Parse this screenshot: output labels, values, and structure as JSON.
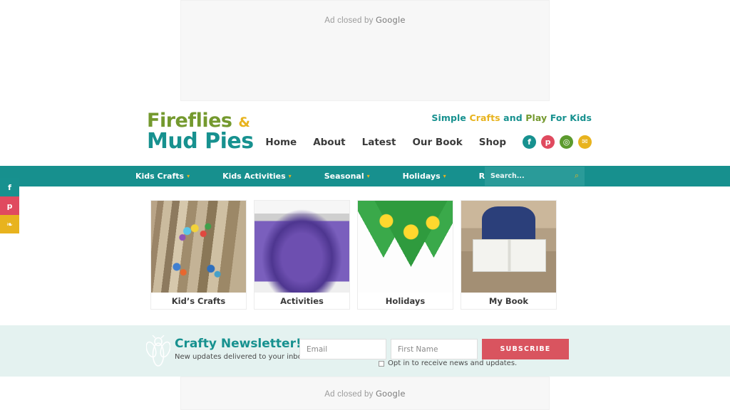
{
  "ads": {
    "top_label_prefix": "Ad closed by ",
    "top_label_brand": "Google",
    "bottom_label_prefix": "Ad closed by ",
    "bottom_label_brand": "Google"
  },
  "colors": {
    "teal": "#17918f",
    "navbar_teal": "#17908e",
    "gold": "#e8b31e",
    "green": "#74992e",
    "red": "#d9545f",
    "newsletter_bg": "#e4f2f0",
    "pinterest_red": "#e04a5f",
    "instagram_green": "#5c9a2e"
  },
  "logo": {
    "line1": "Fireflies",
    "ampersand": "&",
    "line2_word1": "Mud",
    "line2_word2": "Pies"
  },
  "tagline": {
    "part1": "Simple ",
    "part2": "Crafts ",
    "part3": "and ",
    "part4": "Play ",
    "part5": "For Kids"
  },
  "topnav": {
    "items": [
      {
        "label": "Home"
      },
      {
        "label": "About"
      },
      {
        "label": "Latest"
      },
      {
        "label": "Our Book"
      },
      {
        "label": "Shop"
      }
    ],
    "social": [
      {
        "name": "facebook-icon",
        "glyph": "f"
      },
      {
        "name": "pinterest-icon",
        "glyph": "p"
      },
      {
        "name": "instagram-icon",
        "glyph": "◎"
      },
      {
        "name": "email-icon",
        "glyph": "✉"
      }
    ]
  },
  "navbar": {
    "items": [
      {
        "label": "Kids Crafts",
        "caret": "▾"
      },
      {
        "label": "Kids Activities",
        "caret": "▾"
      },
      {
        "label": "Seasonal",
        "caret": "▾"
      },
      {
        "label": "Holidays",
        "caret": "▾"
      },
      {
        "label": "Recipes",
        "caret": ""
      }
    ]
  },
  "search": {
    "placeholder": "Search...",
    "icon": "⌕"
  },
  "share_rail": [
    {
      "name": "share-facebook",
      "glyph": "f"
    },
    {
      "name": "share-pinterest",
      "glyph": "p"
    },
    {
      "name": "share-twitter",
      "glyph": "❧"
    }
  ],
  "cards": [
    {
      "label": "Kid’s Crafts"
    },
    {
      "label": "Activities"
    },
    {
      "label": "Holidays"
    },
    {
      "label": "My Book"
    }
  ],
  "newsletter": {
    "title": "Crafty Newsletter!",
    "subtitle": "New updates delivered to your inbox!",
    "email_placeholder": "Email",
    "email_value": "",
    "firstname_placeholder": "First Name",
    "firstname_value": "",
    "subscribe_label": "SUBSCRIBE",
    "optin_label": "Opt in to receive news and updates.",
    "optin_checked": false
  }
}
